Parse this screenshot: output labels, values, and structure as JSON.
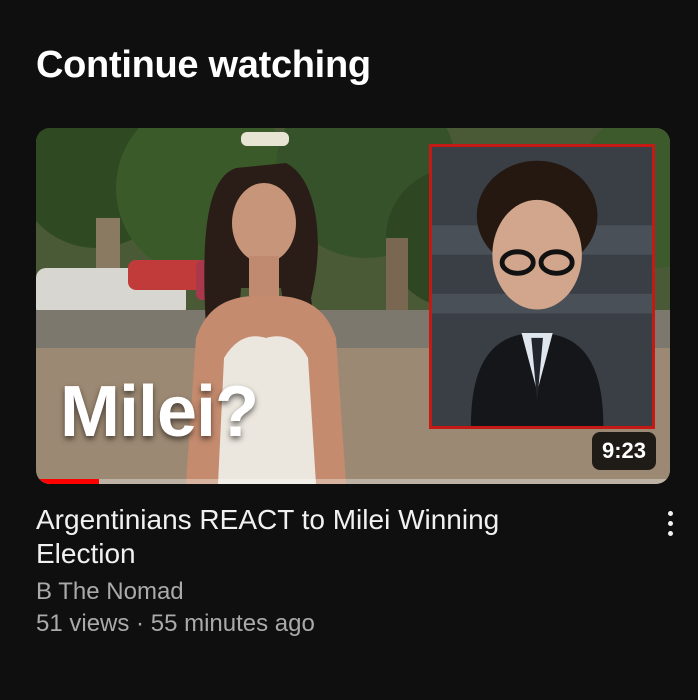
{
  "section": {
    "title": "Continue watching"
  },
  "video": {
    "overlay_text": "Milei?",
    "duration": "9:23",
    "progress_fraction": 0.1,
    "title": "Argentinians REACT to Milei Winning Election",
    "channel": "B The Nomad",
    "views": "51 views",
    "separator": "·",
    "age": "55 minutes ago",
    "more_icon": "more-vertical-icon"
  },
  "colors": {
    "progress": "#ff0000",
    "inset_border": "#c41a16",
    "background": "#0f0f0f"
  }
}
